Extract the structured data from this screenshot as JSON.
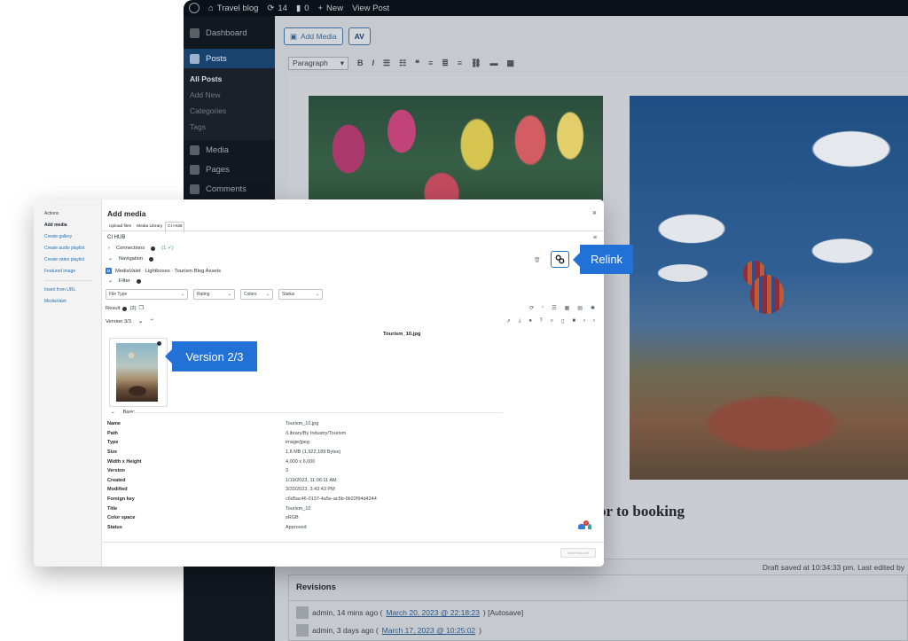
{
  "wp": {
    "adminbar": {
      "site_name": "Travel blog",
      "updates_count": "14",
      "comments_count": "0",
      "new_label": "New",
      "view_post_label": "View Post"
    },
    "sidebar": {
      "dashboard": "Dashboard",
      "posts": "Posts",
      "posts_sub": [
        "All Posts",
        "Add New",
        "Categories",
        "Tags"
      ],
      "media": "Media",
      "pages": "Pages",
      "comments": "Comments"
    },
    "editor": {
      "add_media_label": "Add Media",
      "format_select": "Paragraph",
      "caption_text": "or to booking",
      "draft_status": "Draft saved at 10:34:33 pm. Last edited by"
    },
    "revisions": {
      "title": "Revisions",
      "rows": [
        {
          "author": "admin, 14 mins ago (",
          "link": "March 20, 2023 @ 22:18:23",
          "suffix": ") [Autosave]"
        },
        {
          "author": "admin, 3 days ago (",
          "link": "March 17, 2023 @ 10:25:02",
          "suffix": ")"
        }
      ]
    }
  },
  "modal": {
    "sidebar": {
      "heading": "Actions",
      "links": [
        "Add media",
        "Create gallery",
        "Create audio playlist",
        "Create video playlist",
        "Featured image"
      ],
      "links2": [
        "Insert from URL",
        "MediaValet"
      ]
    },
    "title": "Add media",
    "close": "×",
    "tabs": [
      "Upload files",
      "Media Library",
      "CI HUB"
    ],
    "ci_hub_label": "CI HUB",
    "connections_label": "Connections",
    "connections_count": "(1 ✓)",
    "navigation_label": "Navigation",
    "breadcrumb": "MediaValet · Lightboxes · Tourism Blog Assets",
    "filter_label": "Filter",
    "filters": [
      "File Type",
      "Rating",
      "Colors",
      "Status"
    ],
    "result_label": "Result",
    "result_count": "3",
    "version_label": "Version 3/3",
    "file_title": "Tourism_10.jpg",
    "basic_label": "Basic",
    "metadata": [
      {
        "key": "Name",
        "value": "Tourism_10.jpg"
      },
      {
        "key": "Path",
        "value": "/Library/By Industry/Tourism"
      },
      {
        "key": "Type",
        "value": "image/jpeg"
      },
      {
        "key": "Size",
        "value": "1.8 MB (1,922,189 Bytes)"
      },
      {
        "key": "Width x Height",
        "value": "4,000 x 6,000"
      },
      {
        "key": "Version",
        "value": "3"
      },
      {
        "key": "Created",
        "value": "1/19/2023, 11:06:11 AM"
      },
      {
        "key": "Modified",
        "value": "3/20/2023, 3:43:43 PM"
      },
      {
        "key": "Foreign key",
        "value": "c6d5ac46-0137-4a5e-ac5b-0b22f94d4244"
      },
      {
        "key": "Title",
        "value": "Tourism_10"
      },
      {
        "key": "Color space",
        "value": "sRGB"
      },
      {
        "key": "Status",
        "value": "Approved"
      }
    ],
    "notification_count": "1",
    "insert_button": "Insert into post"
  },
  "callouts": {
    "relink": "Relink",
    "version": "Version 2/3"
  },
  "colors": {
    "accent": "#2271d6",
    "wp_sidebar": "#121820",
    "wp_adminbar": "#0c1119"
  }
}
